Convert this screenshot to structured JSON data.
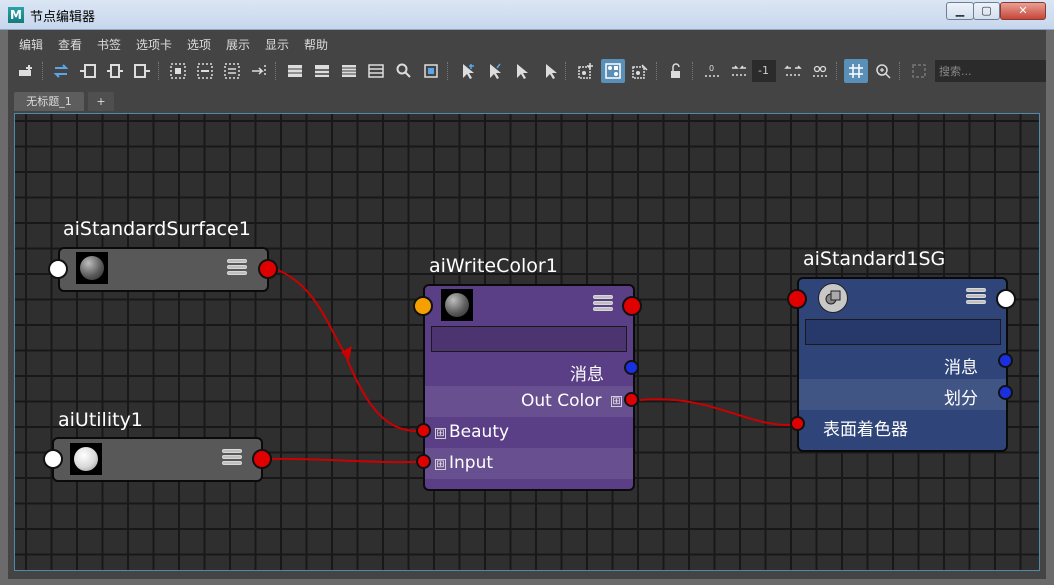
{
  "window": {
    "title": "节点编辑器",
    "app_icon": "M",
    "minimize": "▁",
    "maximize": "▢",
    "close": "✕"
  },
  "menubar": [
    "编辑",
    "查看",
    "书签",
    "选项卡",
    "选项",
    "展示",
    "显示",
    "帮助"
  ],
  "toolbar": {
    "field_value": "-1",
    "search_placeholder": "搜索..."
  },
  "tabs": {
    "items": [
      "无标题_1"
    ],
    "add_label": "+"
  },
  "graph": {
    "nodes": {
      "surface": {
        "title": "aiStandardSurface1"
      },
      "utility": {
        "title": "aiUtility1"
      },
      "writecolor": {
        "title": "aiWriteColor1",
        "attrs": [
          "消息",
          "Out Color",
          "Beauty",
          "Input"
        ]
      },
      "sg": {
        "title": "aiStandard1SG",
        "attrs": [
          "消息",
          "划分",
          "表面着色器"
        ]
      }
    },
    "expander_glyph": "⊞",
    "colors": {
      "connection": "#cc0000",
      "port_red": "#e00000",
      "port_blue": "#1a2fe0",
      "port_orange": "#f5a000",
      "writecolor_node": "#5a3f86",
      "sg_node": "#2f4579",
      "selection_border": "#4f8aa8"
    }
  }
}
